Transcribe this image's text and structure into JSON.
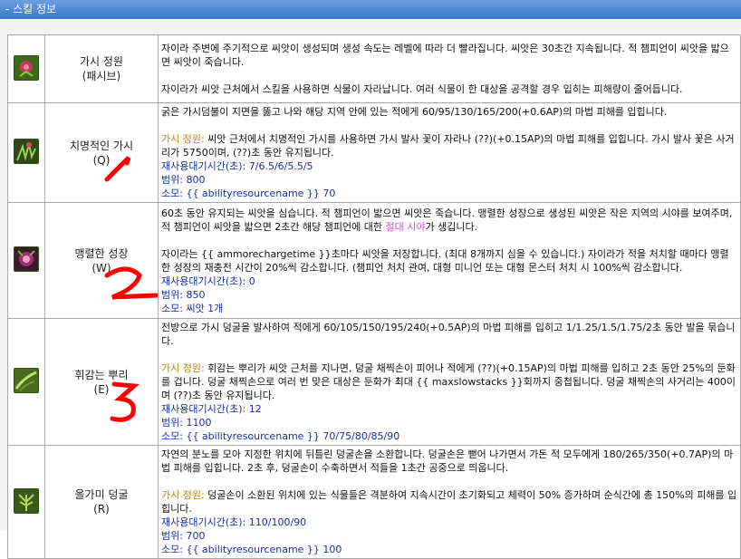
{
  "header": {
    "title": "- 스킬 정보"
  },
  "skills": [
    {
      "name": "가시 정원",
      "key": "(패시브)",
      "icon": "rose-icon",
      "desc1": "자이라 주변에 주기적으로 씨앗이 생성되며 생성 속도는 레벨에 따라 더 빨라집니다. 씨앗은 30초간 지속됩니다. 적 챔피언이 씨앗을 밟으면 씨앗이 죽습니다.",
      "desc2": "자이라가 씨앗 근처에서 스킬을 사용하면 식물이 자라납니다. 여러 식물이 한 대상을 공격할 경우 입히는 피해량이 줄어듭니다."
    },
    {
      "name": "치명적인 가시",
      "key": "(Q)",
      "icon": "thorn-icon",
      "desc1": "굵은 가시덤불이 지면을 뚫고 나와 해당 지역 안에 있는 적에게 60/95/130/165/200(+0.6AP)의 마법 피해를 입힙니다.",
      "passive_label": "가시 정원:",
      "passive_text": " 씨앗 근처에서 치명적인 가시를 사용하면 가시 발사 꽃이 자라나 (??)(+0.15AP)의 마법 피해를 입힙니다. 가시 발사 꽃은 사거리가 5750이며, (??)초 동안 유지됩니다.",
      "cooldown": "재사용대기시간(초): 7/6.5/6/5.5/5",
      "range": "범위: 800",
      "cost": "소모: {{ abilityresourcename }} 70"
    },
    {
      "name": "맹렬한 성장",
      "key": "(W)",
      "icon": "seed-icon",
      "desc1a": "60초 동안 유지되는 씨앗을 심습니다. 적 챔피언이 밟으면 씨앗은 죽습니다. 맹렬한 성장으로 생성된 씨앗은 작은 지역의 시야를 보여주며, 적 챔피언이 씨앗을 밟으면 2초간 해당 챔피언에 대한 ",
      "desc1_highlight": "절대 시야",
      "desc1b": "가 생깁니다.",
      "desc2": "자이라는 {{ ammorechargetime }}초마다 씨앗을 저장합니다. (최대 8개까지 심을 수 있습니다.) 자이라가 적을 처치할 때마다 맹렬한 성장의 재충전 시간이 20%씩 감소합니다. (챔피언 처치 관여, 대형 미니언 또는 대형 몬스터 처치 시 100%씩 감소합니다.",
      "cooldown": "재사용대기시간(초): 0",
      "range": "범위: 850",
      "cost": "소모: 씨앗 1개"
    },
    {
      "name": "휘감는 뿌리",
      "key": "(E)",
      "icon": "root-icon",
      "desc1": "전방으로 가시 덩굴을 발사하여 적에게 60/105/150/195/240(+0.5AP)의 마법 피해를 입히고 1/1.25/1.5/1.75/2초 동안 발을 묶습니다.",
      "passive_label": "가시 정원:",
      "passive_text": " 휘감는 뿌리가 씨앗 근처를 지나면, 덩굴 채찍손이 피어나 적에게 (??)(+0.15AP)의 마법 피해를 입히고 2초 동안 25%의 둔화를 겁니다. 덩굴 채찍손으로 여러 번 맞은 대상은 둔화가 최대 {{ maxslowstacks }}회까지 중첩됩니다. 덩굴 채찍손의 사거리는 400이며 (??)초 동안 유지됩니다.",
      "cooldown": "재사용대기시간(초): 12",
      "range": "범위: 1100",
      "cost": "소모: {{ abilityresourcename }} 70/75/80/85/90"
    },
    {
      "name": "올가미 덩굴",
      "key": "(R)",
      "icon": "vines-icon",
      "desc1": "자연의 분노를 모아 지정한 위치에 뒤틀린 덩굴손을 소환합니다. 덩굴손은 뻗어 나가면서 가돈 적 모두에게 180/265/350(+0.7AP)의 마법 피해를 입힙니다. 2초 후, 덩굴손이 수축하면서 적들을 1초간 공중으로 띄웁니다.",
      "passive_label": "가시 정원:",
      "passive_text": " 덩굴손이 소환된 위치에 있는 식물들은 격분하여 지속시간이 초기화되고 체력이 50% 증가하며 순식간에 총 150%의 피해를 입힙니다.",
      "cooldown": "재사용대기시간(초): 110/100/90",
      "range": "범위: 700",
      "cost": "소모: {{ abilityresourcename }} 100"
    }
  ],
  "annotations": [
    "1",
    "2",
    "3"
  ],
  "colors": {
    "header": "#3a74c8",
    "passive": "#b8860b",
    "stats": "#1a2fa0",
    "highlight": "#d54bd5",
    "annotation": "#ff0000"
  }
}
